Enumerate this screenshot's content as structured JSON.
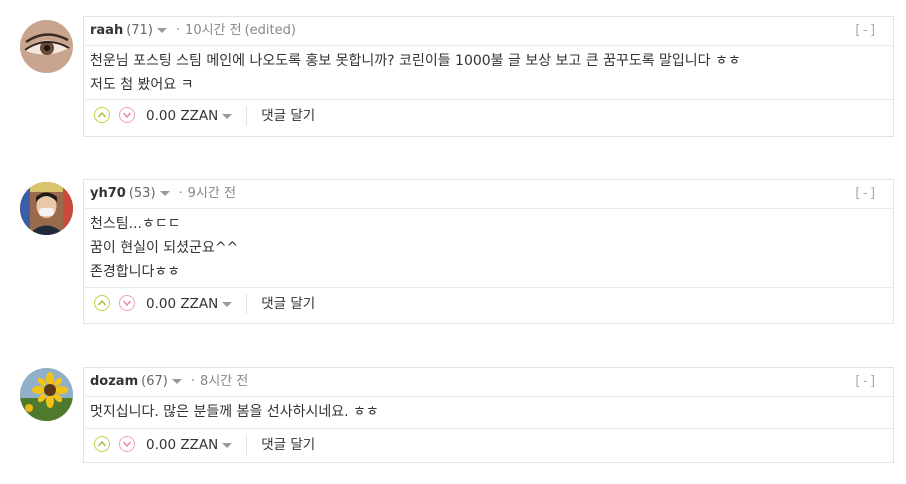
{
  "comments": [
    {
      "author": "raah",
      "reputation": "(71)",
      "dot": "·",
      "time": "10시간 전",
      "edited": "(edited)",
      "collapse": "[-]",
      "lines": [
        "천운님 포스팅 스팀 메인에 나오도록 홍보 못합니까? 코린이들 1000불 글 보상 보고 큰 꿈꾸도록 말입니다 ㅎㅎ",
        "저도 첨 봤어요 ㅋ"
      ],
      "payout": "0.00 ZZAN",
      "reply_label": "댓글 달기",
      "avatar_icon": "eye-avatar"
    },
    {
      "author": "yh70",
      "reputation": "(53)",
      "dot": "·",
      "time": "9시간 전",
      "edited": "",
      "collapse": "[-]",
      "lines": [
        "천스팀...ㅎㄷㄷ",
        "꿈이 현실이 되셨군요^^",
        "존경합니다ㅎㅎ"
      ],
      "payout": "0.00 ZZAN",
      "reply_label": "댓글 달기",
      "avatar_icon": "person-avatar"
    },
    {
      "author": "dozam",
      "reputation": "(67)",
      "dot": "·",
      "time": "8시간 전",
      "edited": "",
      "collapse": "[-]",
      "lines": [
        "멋지십니다. 많은 분들께 봄을 선사하시네요. ㅎㅎ"
      ],
      "payout": "0.00 ZZAN",
      "reply_label": "댓글 달기",
      "avatar_icon": "sunflower-avatar"
    }
  ]
}
